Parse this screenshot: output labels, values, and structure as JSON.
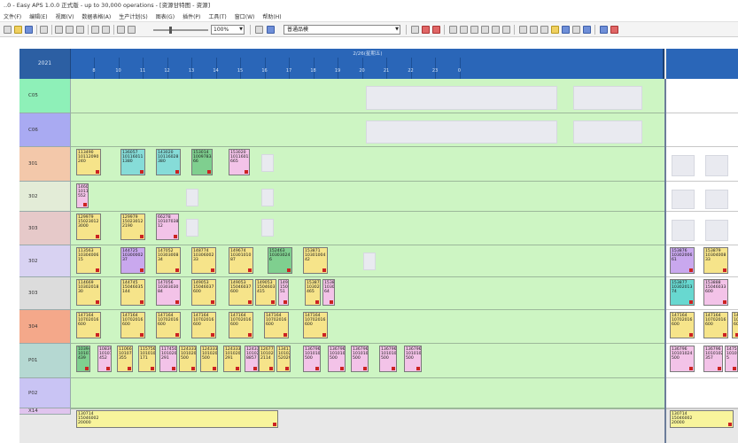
{
  "window": {
    "title": "..0 - Easy APS 1.0.0 正式版 - up to 30,000 operations - [资源甘特图 - 资源]"
  },
  "menu": {
    "items": [
      "文件(F)",
      "编辑(E)",
      "视图(V)",
      "数据表格(A)",
      "生产计划(S)",
      "图表(G)",
      "插件(P)",
      "工具(T)",
      "窗口(W)",
      "帮助(H)"
    ]
  },
  "toolbar": {
    "zoom_value": "100%",
    "mode_value": "普通品模"
  },
  "gantt": {
    "corner_label": "2021",
    "period_label": "2/26(星期五)",
    "ticks": [
      "8",
      "10",
      "11",
      "12",
      "13",
      "14",
      "15",
      "16",
      "17",
      "18",
      "19",
      "20",
      "21",
      "22",
      "23",
      "0"
    ],
    "rows": [
      {
        "label": "C05",
        "jobs": []
      },
      {
        "label": "C06",
        "jobs": []
      },
      {
        "label": "301",
        "jobs": [
          {
            "lines": [
              "113490",
              "10112090",
              "240"
            ],
            "color": "#f6e48a"
          },
          {
            "lines": [
              "136057",
              "10116011",
              "1380"
            ],
            "color": "#86dcd8"
          },
          {
            "lines": [
              "143020",
              "10116028",
              "380"
            ],
            "color": "#86dcd8"
          },
          {
            "lines": [
              "153014",
              "10097834",
              "66"
            ],
            "color": "#7fcf8f"
          },
          {
            "lines": [
              "153020",
              "10116012",
              "665"
            ],
            "color": "#f3c3e8"
          }
        ]
      },
      {
        "label": "302",
        "jobs": [
          {
            "lines": [
              "146005",
              "10110000",
              "552"
            ],
            "color": "#f3c3e8"
          }
        ]
      },
      {
        "label": "303",
        "jobs": [
          {
            "lines": [
              "129979",
              "15023012",
              "3000"
            ],
            "color": "#f6e48a"
          },
          {
            "lines": [
              "129979",
              "15023012",
              "2190"
            ],
            "color": "#f6e48a"
          },
          {
            "lines": [
              "66278",
              "10107038",
              "12"
            ],
            "color": "#f3c3e8"
          }
        ]
      },
      {
        "label": "302",
        "jobs": [
          {
            "lines": [
              "113563",
              "10304006",
              "15"
            ],
            "color": "#f6e48a"
          },
          {
            "lines": [
              "144725",
              "10300002",
              "37"
            ],
            "color": "#c9a8ee"
          },
          {
            "lines": [
              "147052",
              "10303008",
              "34"
            ],
            "color": "#f6e48a"
          },
          {
            "lines": [
              "148774",
              "10306002",
              "33"
            ],
            "color": "#f6e48a"
          },
          {
            "lines": [
              "149674",
              "10301010",
              "87"
            ],
            "color": "#f6e48a"
          },
          {
            "lines": [
              "152463",
              "10303024",
              "6"
            ],
            "color": "#7fcf8f"
          },
          {
            "lines": [
              "153871",
              "10301004",
              "42"
            ],
            "color": "#f6e48a"
          },
          {
            "lines": [
              "153876",
              "10302006",
              "61"
            ],
            "color": "#c9a8ee"
          },
          {
            "lines": [
              "153879",
              "10304008",
              "33"
            ],
            "color": "#f6e48a"
          }
        ]
      },
      {
        "label": "303",
        "jobs": [
          {
            "lines": [
              "114669",
              "10302018",
              "30"
            ],
            "color": "#f6e48a"
          },
          {
            "lines": [
              "144745",
              "15046035",
              "144"
            ],
            "color": "#f6e48a"
          },
          {
            "lines": [
              "147056",
              "10303030",
              "84"
            ],
            "color": "#f3c3e8"
          },
          {
            "lines": [
              "149053",
              "15046037",
              "600"
            ],
            "color": "#f6e48a"
          },
          {
            "lines": [
              "149053",
              "15046037",
              "600"
            ],
            "color": "#f6e48a"
          },
          {
            "lines": [
              "149053",
              "15046037",
              "415"
            ],
            "color": "#f6e48a"
          },
          {
            "lines": [
              "149053",
              "15046037",
              "51"
            ],
            "color": "#f3c3e8"
          },
          {
            "lines": [
              "153873",
              "10302004",
              "465"
            ],
            "color": "#f6e48a"
          },
          {
            "lines": [
              "153873",
              "10302001",
              "64"
            ],
            "color": "#f3c3e8"
          },
          {
            "lines": [
              "153877",
              "10302013",
              "74"
            ],
            "color": "#68d8d0"
          },
          {
            "lines": [
              "153888",
              "15046033",
              "600"
            ],
            "color": "#f3c3e8"
          }
        ]
      },
      {
        "label": "304",
        "jobs": [
          {
            "lines": [
              "147164",
              "10702016",
              "600"
            ],
            "color": "#f6e48a"
          },
          {
            "lines": [
              "147164",
              "10702016",
              "600"
            ],
            "color": "#f6e48a"
          },
          {
            "lines": [
              "147164",
              "10702016",
              "600"
            ],
            "color": "#f6e48a"
          },
          {
            "lines": [
              "147164",
              "10702016",
              "600"
            ],
            "color": "#f6e48a"
          },
          {
            "lines": [
              "147164",
              "10702016",
              "600"
            ],
            "color": "#f6e48a"
          },
          {
            "lines": [
              "147164",
              "10702016",
              "600"
            ],
            "color": "#f6e48a"
          },
          {
            "lines": [
              "147164",
              "10702016",
              "600"
            ],
            "color": "#f6e48a"
          },
          {
            "lines": [
              "147164",
              "10702016",
              "600"
            ],
            "color": "#f6e48a"
          },
          {
            "lines": [
              "147164",
              "10702016",
              "600"
            ],
            "color": "#f6e48a"
          },
          {
            "lines": [
              "147164",
              "10702016",
              "600"
            ],
            "color": "#f6e48a"
          }
        ]
      },
      {
        "label": "P01",
        "jobs": [
          {
            "lines": [
              "103949",
              "10107008",
              "439"
            ],
            "color": "#7fcf8f"
          },
          {
            "lines": [
              "108396",
              "10107006",
              "452"
            ],
            "color": "#f3c3e8"
          },
          {
            "lines": [
              "110660",
              "10107004",
              "355"
            ],
            "color": "#f6e48a"
          },
          {
            "lines": [
              "115756",
              "10101029",
              "171"
            ],
            "color": "#f6e48a"
          },
          {
            "lines": [
              "117450",
              "10102022",
              "291"
            ],
            "color": "#f3c3e8"
          },
          {
            "lines": [
              "124333",
              "10102019",
              "500"
            ],
            "color": "#f6e48a"
          },
          {
            "lines": [
              "124333",
              "10102019",
              "500"
            ],
            "color": "#f6e48a"
          },
          {
            "lines": [
              "124333",
              "10102019",
              "291"
            ],
            "color": "#f6e48a"
          },
          {
            "lines": [
              "124333",
              "10102019",
              "8857"
            ],
            "color": "#f3c3e8"
          },
          {
            "lines": [
              "126775",
              "10102001",
              "2114"
            ],
            "color": "#f6e48a"
          },
          {
            "lines": [
              "134171",
              "10102004",
              "52029"
            ],
            "color": "#f6e48a"
          },
          {
            "lines": [
              "136796",
              "10101024",
              "500"
            ],
            "color": "#f3c3e8"
          },
          {
            "lines": [
              "136796",
              "10101024",
              "500"
            ],
            "color": "#f3c3e8"
          },
          {
            "lines": [
              "136796",
              "10101024",
              "500"
            ],
            "color": "#f3c3e8"
          },
          {
            "lines": [
              "136796",
              "10101024",
              "500"
            ],
            "color": "#f3c3e8"
          },
          {
            "lines": [
              "136796",
              "10101024",
              "500"
            ],
            "color": "#f3c3e8"
          },
          {
            "lines": [
              "136796",
              "10101024",
              "500"
            ],
            "color": "#f3c3e8"
          },
          {
            "lines": [
              "136796",
              "10101024",
              "357"
            ],
            "color": "#f3c3e8"
          },
          {
            "lines": [
              "147510",
              "10103002",
              "5"
            ],
            "color": "#f3c3e8"
          }
        ]
      },
      {
        "label": "P02",
        "jobs": []
      },
      {
        "label": "X14",
        "jobs": [
          {
            "lines": [
              "130714",
              "15046002",
              "20000"
            ],
            "color": "#f8f49c"
          },
          {
            "lines": [
              "130714",
              "15046002",
              "20000"
            ],
            "color": "#f8f49c"
          }
        ]
      }
    ]
  },
  "colors": {
    "header_blue": "#2a66b8",
    "row_bg": "#cdf5c3",
    "job_marker": "#cc2222"
  }
}
